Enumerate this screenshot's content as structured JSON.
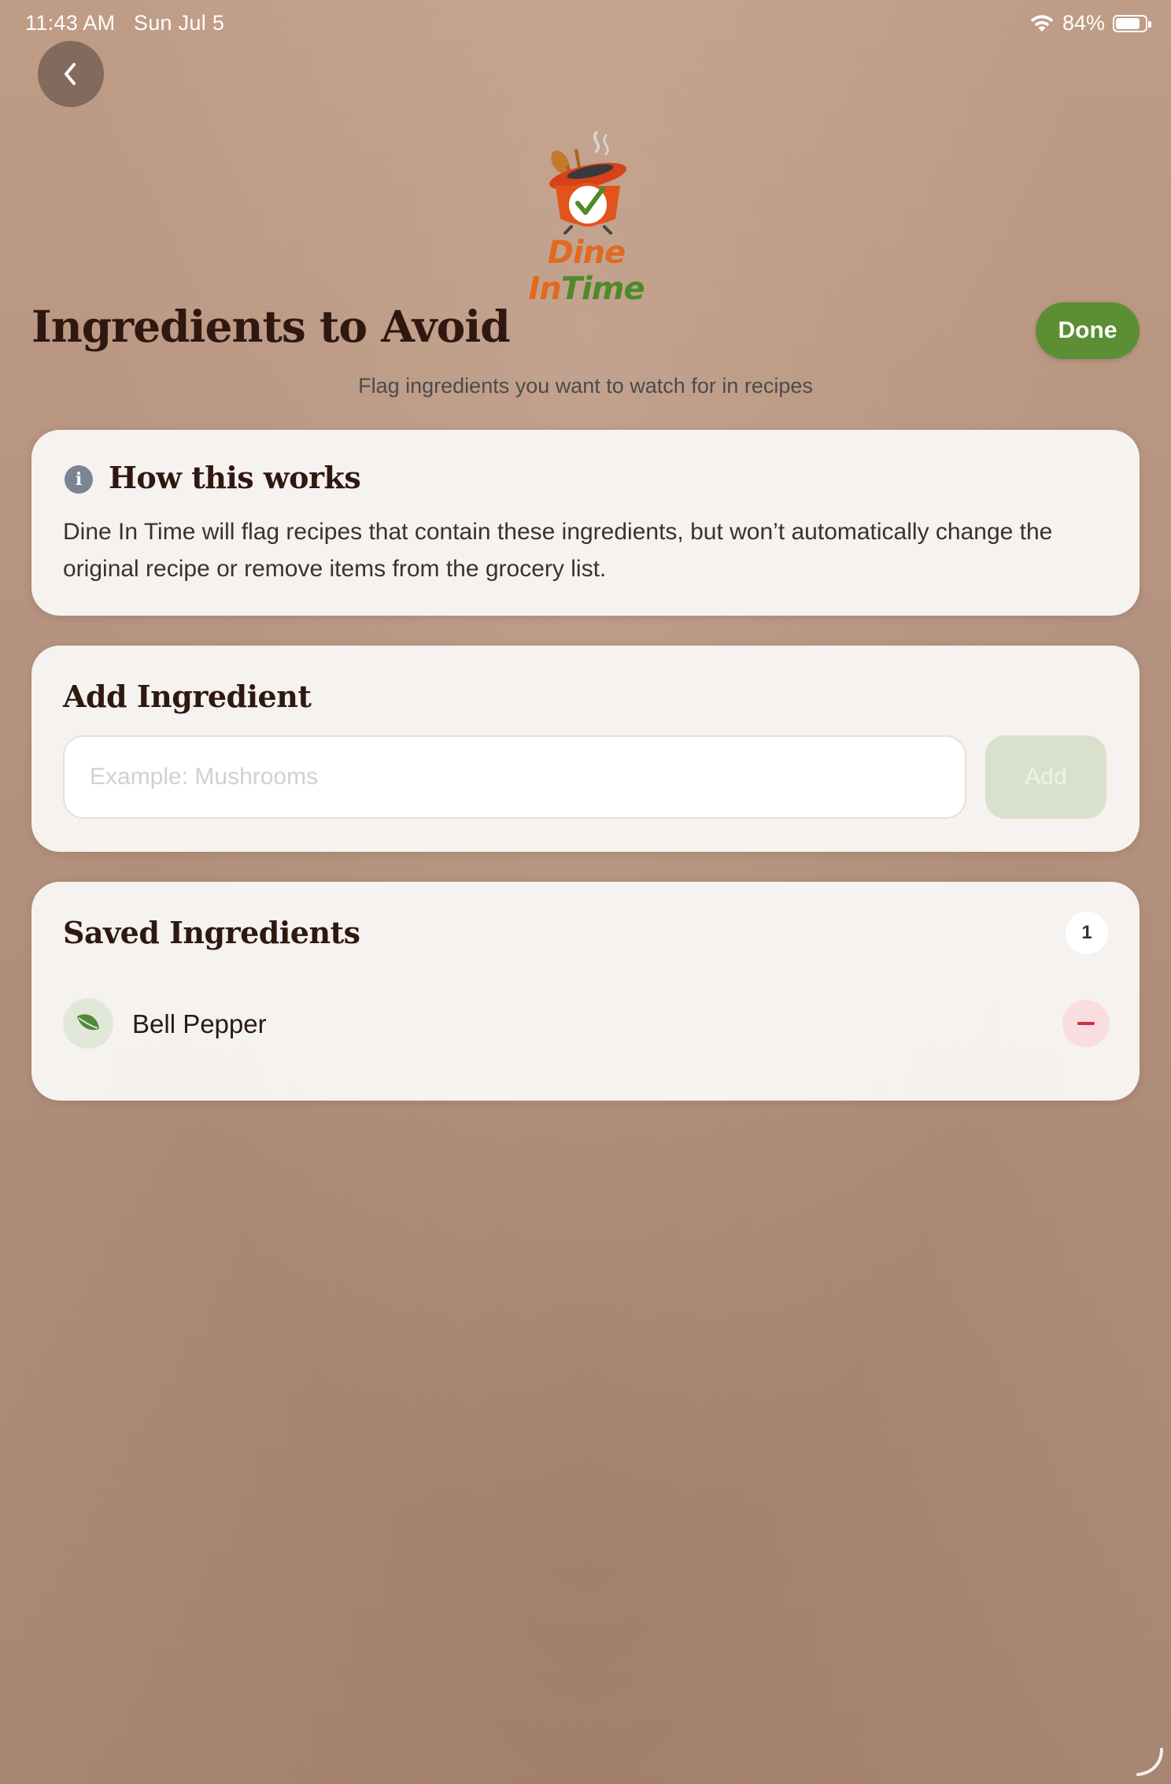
{
  "status_bar": {
    "time": "11:43 AM",
    "date": "Sun Jul 5",
    "battery_text": "84%",
    "battery_level": 0.84
  },
  "nav": {
    "back_icon": "chevron-left-icon"
  },
  "logo": {
    "word1": "Dine",
    "word2": "In",
    "word3": "Time",
    "icon": "cooking-pot-clock-logo"
  },
  "header": {
    "title": "Ingredients to Avoid",
    "done_label": "Done",
    "subtitle": "Flag ingredients you want to watch for in recipes"
  },
  "how_card": {
    "heading": "How this works",
    "body": "Dine In Time will flag recipes that contain these ingredients, but won’t automatically change the original recipe or remove items from the grocery list.",
    "icon": "info-icon"
  },
  "add_card": {
    "heading": "Add Ingredient",
    "input_placeholder": "Example: Mushrooms",
    "input_value": "",
    "add_label": "Add"
  },
  "saved_card": {
    "heading": "Saved Ingredients",
    "count": "1",
    "items": [
      {
        "name": "Bell Pepper",
        "icon": "leaf-icon",
        "remove_icon": "minus-icon"
      }
    ]
  },
  "colors": {
    "accent_green": "#5c8f33",
    "logo_orange": "#e06a1f",
    "remove_red": "#d0303d",
    "title_brown": "#2e1810"
  }
}
